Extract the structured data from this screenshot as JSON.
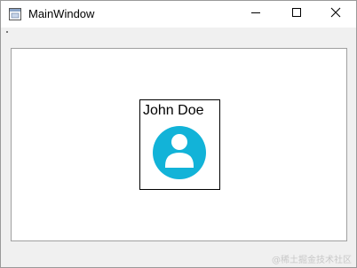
{
  "window": {
    "title": "MainWindow",
    "icons": {
      "app": "app-window-icon",
      "minimize": "minimize-icon",
      "maximize": "maximize-icon",
      "close": "close-icon"
    }
  },
  "card": {
    "name": "John Doe",
    "avatar_icon": "user-avatar-icon",
    "avatar_color": "#12b3d8"
  },
  "watermark": {
    "text": "@稀土掘金技术社区"
  }
}
